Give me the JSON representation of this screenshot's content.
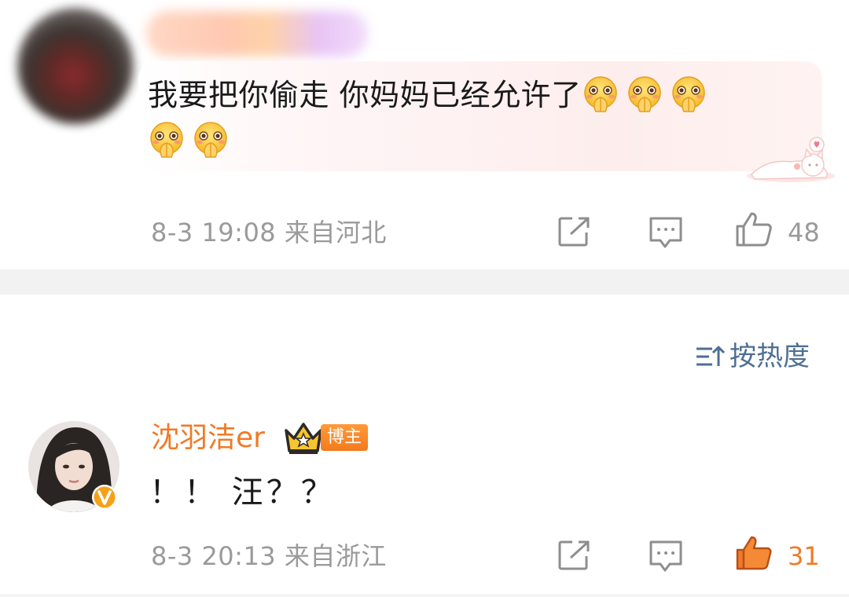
{
  "comments": [
    {
      "text": "我要把你偷走 你妈妈已经允许了",
      "emoji_icon": "praying-face-emoji",
      "emoji_count": 5,
      "time": "8-3 19:08",
      "location": "来自河北",
      "likes": "48",
      "liked": false
    },
    {
      "username": "沈羽洁er",
      "badge": "博主",
      "verified_icon": "v-verified-icon",
      "text": "！！ 汪？？",
      "time": "8-3 20:13",
      "location": "来自浙江",
      "likes": "31",
      "liked": true
    }
  ],
  "sort": {
    "label": "按热度",
    "icon": "sort-icon"
  },
  "icons": {
    "share": "share-icon",
    "reply": "comment-icon",
    "like": "thumbs-up-icon"
  },
  "colors": {
    "username": "#f07a26",
    "sort": "#4f6f93",
    "meta_text": "#9a9a9a",
    "liked": "#f07a26",
    "divider": "#f2f2f2"
  }
}
